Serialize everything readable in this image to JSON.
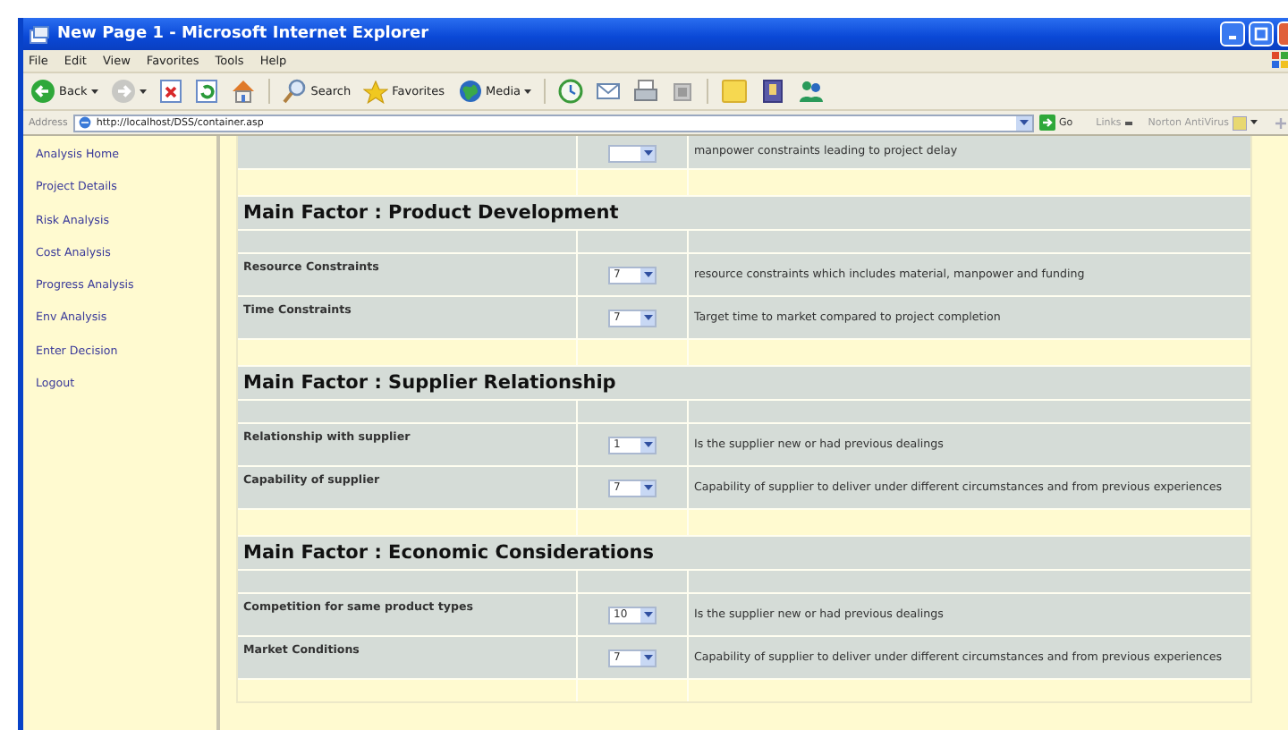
{
  "window": {
    "title": "New Page 1 - Microsoft Internet Explorer"
  },
  "menu": [
    "File",
    "Edit",
    "View",
    "Favorites",
    "Tools",
    "Help"
  ],
  "toolbar": [
    {
      "kind": "back",
      "label": "Back"
    },
    {
      "kind": "forward"
    },
    {
      "kind": "stop"
    },
    {
      "kind": "refresh"
    },
    {
      "kind": "home"
    },
    {
      "kind": "search",
      "label": "Search"
    },
    {
      "kind": "favorites",
      "label": "Favorites"
    },
    {
      "kind": "media",
      "label": "Media"
    },
    {
      "kind": "history"
    },
    {
      "kind": "mail"
    },
    {
      "kind": "print"
    },
    {
      "kind": "edit"
    },
    {
      "kind": "note"
    },
    {
      "kind": "book"
    },
    {
      "kind": "people"
    }
  ],
  "address_bar": {
    "label": "Address",
    "value": "http://localhost/DSS/container.asp",
    "go": "Go",
    "links": "Links",
    "toolbar_item": "Norton AntiVirus"
  },
  "sidebar": {
    "items": [
      "Analysis Home",
      "Project Details",
      "Risk Analysis",
      "Cost Analysis",
      "Progress Analysis",
      "Env Analysis",
      "Enter Decision",
      "Logout"
    ]
  },
  "content": {
    "partial_row": {
      "description": "manpower constraints leading to project delay"
    },
    "sections": [
      {
        "title": "Main Factor : Product Development",
        "factors": [
          {
            "name": "Resource Constraints",
            "value": "7",
            "description": "resource constraints which includes material, manpower and funding"
          },
          {
            "name": "Time Constraints",
            "value": "7",
            "description": "Target time to market compared to project completion"
          }
        ]
      },
      {
        "title": "Main Factor : Supplier Relationship",
        "factors": [
          {
            "name": "Relationship with supplier",
            "value": "1",
            "description": "Is the supplier new or had previous dealings"
          },
          {
            "name": "Capability of supplier",
            "value": "7",
            "description": "Capability of supplier to deliver under different circumstances and from previous experiences"
          }
        ]
      },
      {
        "title": "Main Factor : Economic Considerations",
        "factors": [
          {
            "name": "Competition for same product types",
            "value": "10",
            "description": "Is the supplier new or had previous dealings"
          },
          {
            "name": "Market Conditions",
            "value": "7",
            "description": "Capability of supplier to deliver under different circumstances and from previous experiences"
          }
        ]
      }
    ]
  }
}
